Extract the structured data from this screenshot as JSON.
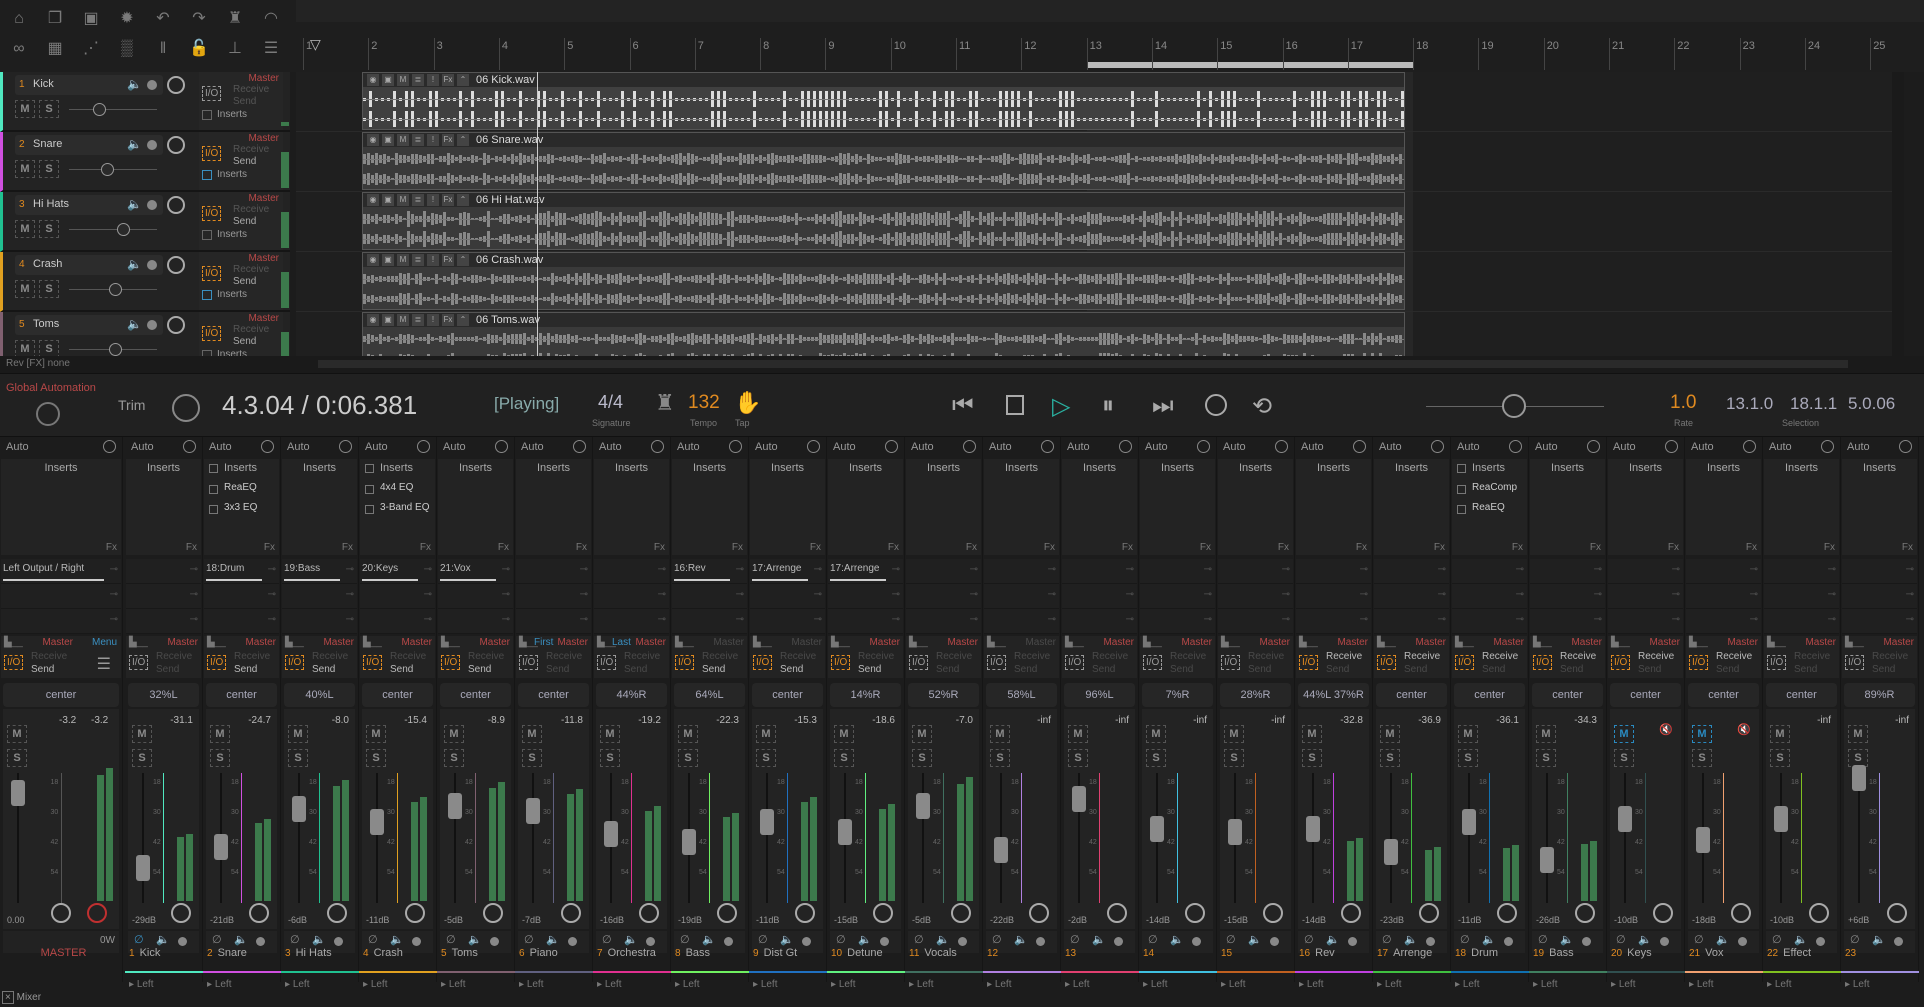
{
  "toolbar": {
    "icons": [
      "home-icon",
      "project-icon",
      "save-icon",
      "gear-icon",
      "undo-icon",
      "redo-icon",
      "metronome-icon",
      "crossfade-icon",
      "link-icon",
      "grid-icon",
      "envelope-icon",
      "snap-grid-icon",
      "ripple-icon",
      "lock-icon",
      "marker-icon",
      "list-icon"
    ]
  },
  "ruler": {
    "bars": [
      "1",
      "2",
      "3",
      "4",
      "5",
      "6",
      "7",
      "8",
      "9",
      "10",
      "11",
      "12",
      "13",
      "14",
      "15",
      "16",
      "17",
      "18",
      "19",
      "20",
      "21",
      "22",
      "23",
      "24",
      "25"
    ],
    "selection_start_bar": 13,
    "selection_end_bar": 18,
    "playhead_bar": 4.6
  },
  "tracks": [
    {
      "num": "1",
      "name": "Kick",
      "color": "#50e8c0",
      "clip": "06 Kick.wav",
      "master": "Master",
      "receive": "Receive",
      "send": "Send",
      "inserts": "Inserts",
      "io_active": false,
      "send_on": false,
      "inserts_on": false,
      "vol_fraction": 0.3
    },
    {
      "num": "2",
      "name": "Snare",
      "color": "#d050e0",
      "clip": "06 Snare.wav",
      "master": "Master",
      "receive": "Receive",
      "send": "Send",
      "inserts": "Inserts",
      "io_active": true,
      "send_on": true,
      "inserts_on": true,
      "vol_fraction": 0.4
    },
    {
      "num": "3",
      "name": "Hi Hats",
      "color": "#20c090",
      "clip": "06 Hi Hat.wav",
      "master": "Master",
      "receive": "Receive",
      "send": "Send",
      "inserts": "Inserts",
      "io_active": true,
      "send_on": true,
      "inserts_on": false,
      "vol_fraction": 0.6
    },
    {
      "num": "4",
      "name": "Crash",
      "color": "#e0a020",
      "clip": "06 Crash.wav",
      "master": "Master",
      "receive": "Receive",
      "send": "Send",
      "inserts": "Inserts",
      "io_active": true,
      "send_on": true,
      "inserts_on": true,
      "vol_fraction": 0.5
    },
    {
      "num": "5",
      "name": "Toms",
      "color": "#806070",
      "clip": "06 Toms.wav",
      "master": "Master",
      "receive": "Receive",
      "send": "Send",
      "inserts": "Inserts",
      "io_active": true,
      "send_on": true,
      "inserts_on": false,
      "vol_fraction": 0.5
    }
  ],
  "arrange_footer": {
    "text": "Rev [FX] none"
  },
  "transport": {
    "global_automation": "Global Automation",
    "trim": "Trim",
    "position": "4.3.04 / 0:06.381",
    "state": "[Playing]",
    "signature": "4/4",
    "signature_label": "Signature",
    "tempo": "132",
    "tempo_label": "Tempo",
    "tap_label": "Tap",
    "rate": "1.0",
    "rate_label": "Rate",
    "selection_start": "13.1.0",
    "selection_end": "18.1.1",
    "selection_length": "5.0.06",
    "selection_label": "Selection",
    "colors": {
      "accent": "#e08a20",
      "play": "#2ab0a0"
    }
  },
  "mixer": {
    "auto": "Auto",
    "inserts_label": "Inserts",
    "fx": "Fx",
    "master_label": "Master",
    "receive": "Receive",
    "send": "Send",
    "left": "Left",
    "scale": [
      "18",
      "30",
      "42",
      "54"
    ],
    "tab": "Mixer",
    "master": {
      "name": "MASTER",
      "pan": "center",
      "peak_l": "-3.2",
      "peak_r": "-3.2",
      "vol": "0.00",
      "watts": "0W",
      "output": "Left Output / Right",
      "menu": "Menu",
      "io_active": true,
      "send_on": true
    },
    "strips": [
      {
        "num": "1",
        "name": "Kick",
        "color": "#50e8c0",
        "pan": "32%L",
        "peak": "-31.1",
        "vol": "-29dB",
        "out": "",
        "io": false,
        "rcv": false,
        "snd": false,
        "master_on": true,
        "ins": []
      },
      {
        "num": "2",
        "name": "Snare",
        "color": "#d050e0",
        "pan": "center",
        "peak": "-24.7",
        "vol": "-21dB",
        "out": "18:Drum",
        "io": true,
        "rcv": false,
        "snd": true,
        "master_on": true,
        "ins": [
          "ReaEQ",
          "3x3 EQ"
        ]
      },
      {
        "num": "3",
        "name": "Hi Hats",
        "color": "#20c090",
        "pan": "40%L",
        "peak": "-8.0",
        "vol": "-6dB",
        "out": "19:Bass",
        "io": true,
        "rcv": false,
        "snd": true,
        "master_on": true,
        "ins": []
      },
      {
        "num": "4",
        "name": "Crash",
        "color": "#e0a020",
        "pan": "center",
        "peak": "-15.4",
        "vol": "-11dB",
        "out": "20:Keys",
        "io": true,
        "rcv": false,
        "snd": true,
        "master_on": true,
        "ins": [
          "4x4 EQ",
          "3-Band EQ"
        ]
      },
      {
        "num": "5",
        "name": "Toms",
        "color": "#806070",
        "pan": "center",
        "peak": "-8.9",
        "vol": "-5dB",
        "out": "21:Vox",
        "io": true,
        "rcv": false,
        "snd": true,
        "master_on": true,
        "ins": []
      },
      {
        "num": "6",
        "name": "Piano",
        "color": "#606080",
        "pan": "center",
        "peak": "-11.8",
        "vol": "-7dB",
        "out": "",
        "io": false,
        "rcv": false,
        "snd": false,
        "master_on": true,
        "link": "First",
        "ins": []
      },
      {
        "num": "7",
        "name": "Orchestra",
        "color": "#e03090",
        "pan": "44%R",
        "peak": "-19.2",
        "vol": "-16dB",
        "out": "",
        "io": false,
        "rcv": false,
        "snd": false,
        "master_on": true,
        "link": "Last",
        "ins": []
      },
      {
        "num": "8",
        "name": "Bass",
        "color": "#70f060",
        "pan": "64%L",
        "peak": "-22.3",
        "vol": "-19dB",
        "out": "16:Rev",
        "io": true,
        "rcv": false,
        "snd": true,
        "master_on": false,
        "ins": []
      },
      {
        "num": "9",
        "name": "Dist Gt",
        "color": "#2070c0",
        "pan": "center",
        "peak": "-15.3",
        "vol": "-11dB",
        "out": "17:Arrenge",
        "io": true,
        "rcv": false,
        "snd": true,
        "master_on": false,
        "ins": []
      },
      {
        "num": "10",
        "name": "Detune",
        "color": "#60f080",
        "pan": "14%R",
        "peak": "-18.6",
        "vol": "-15dB",
        "out": "17:Arrenge",
        "io": true,
        "rcv": false,
        "snd": true,
        "master_on": true,
        "ins": []
      },
      {
        "num": "11",
        "name": "Vocals",
        "color": "#407060",
        "pan": "52%R",
        "peak": "-7.0",
        "vol": "-5dB",
        "out": "",
        "io": false,
        "rcv": false,
        "snd": false,
        "master_on": true,
        "ins": []
      },
      {
        "num": "12",
        "name": "",
        "color": "#b080e0",
        "pan": "58%L",
        "peak": "-inf",
        "vol": "-22dB",
        "out": "",
        "io": false,
        "rcv": false,
        "snd": false,
        "master_on": false,
        "ins": []
      },
      {
        "num": "13",
        "name": "",
        "color": "#e04070",
        "pan": "96%L",
        "peak": "-inf",
        "vol": "-2dB",
        "out": "",
        "io": false,
        "rcv": false,
        "snd": false,
        "master_on": true,
        "ins": []
      },
      {
        "num": "14",
        "name": "",
        "color": "#40c0e0",
        "pan": "7%R",
        "peak": "-inf",
        "vol": "-14dB",
        "out": "",
        "io": false,
        "rcv": false,
        "snd": false,
        "master_on": true,
        "ins": []
      },
      {
        "num": "15",
        "name": "",
        "color": "#c06020",
        "pan": "28%R",
        "peak": "-inf",
        "vol": "-15dB",
        "out": "",
        "io": false,
        "rcv": false,
        "snd": false,
        "master_on": true,
        "ins": []
      },
      {
        "num": "16",
        "name": "Rev",
        "color": "#c040e0",
        "pan": "44%L  37%R",
        "peak": "-32.8",
        "vol": "-14dB",
        "out": "",
        "io": true,
        "rcv": true,
        "snd": false,
        "master_on": true,
        "ins": []
      },
      {
        "num": "17",
        "name": "Arrenge",
        "color": "#40c040",
        "pan": "center",
        "peak": "-36.9",
        "vol": "-23dB",
        "out": "",
        "io": true,
        "rcv": true,
        "snd": false,
        "master_on": true,
        "ins": []
      },
      {
        "num": "18",
        "name": "Drum",
        "color": "#1070b0",
        "pan": "center",
        "peak": "-36.1",
        "vol": "-11dB",
        "out": "",
        "io": true,
        "rcv": true,
        "snd": false,
        "master_on": true,
        "ins": [
          "ReaComp",
          "ReaEQ"
        ]
      },
      {
        "num": "19",
        "name": "Bass",
        "color": "#408060",
        "pan": "center",
        "peak": "-34.3",
        "vol": "-26dB",
        "out": "",
        "io": true,
        "rcv": true,
        "snd": false,
        "master_on": true,
        "ins": []
      },
      {
        "num": "20",
        "name": "Keys",
        "color": "#305050",
        "pan": "center",
        "peak": "",
        "muted": true,
        "vol": "-10dB",
        "out": "",
        "io": true,
        "rcv": true,
        "snd": false,
        "master_on": true,
        "ins": []
      },
      {
        "num": "21",
        "name": "Vox",
        "color": "#f0a070",
        "pan": "center",
        "peak": "",
        "muted": true,
        "vol": "-18dB",
        "out": "",
        "io": true,
        "rcv": true,
        "snd": false,
        "master_on": true,
        "ins": []
      },
      {
        "num": "22",
        "name": "Effect",
        "color": "#80c020",
        "pan": "center",
        "peak": "-inf",
        "vol": "-10dB",
        "out": "",
        "io": false,
        "rcv": false,
        "snd": false,
        "master_on": true,
        "ins": []
      },
      {
        "num": "23",
        "name": "",
        "color": "#a090e0",
        "pan": "89%R",
        "peak": "-inf",
        "vol": "+6dB",
        "out": "",
        "io": false,
        "rcv": false,
        "snd": false,
        "master_on": true,
        "ins": []
      }
    ]
  }
}
